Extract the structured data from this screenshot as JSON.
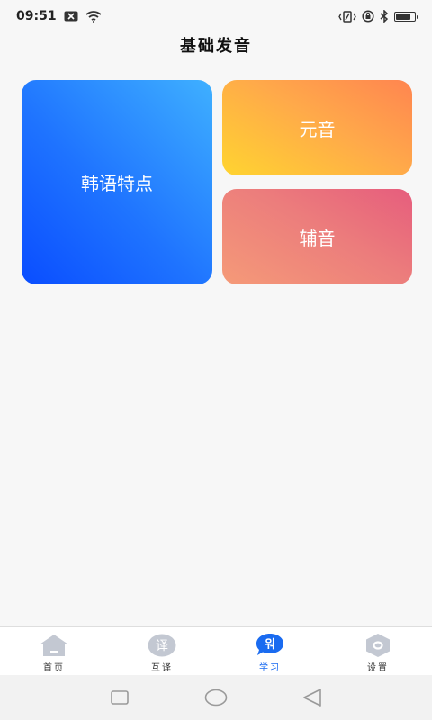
{
  "status_bar": {
    "time": "09:51",
    "icons": [
      "notification-x-icon",
      "wifi-icon",
      "vibrate-icon",
      "data-saver-icon",
      "bluetooth-icon",
      "battery-icon"
    ],
    "battery_level": 0.8
  },
  "header": {
    "title": "基础发音"
  },
  "cards": {
    "korean_features": {
      "label": "韩语特点"
    },
    "vowels": {
      "label": "元音"
    },
    "consonants": {
      "label": "辅音"
    }
  },
  "tab_bar": {
    "items": [
      {
        "label": "首页",
        "icon": "home-icon",
        "icon_text": "",
        "active": false
      },
      {
        "label": "互译",
        "icon": "translate-icon",
        "icon_text": "译",
        "active": false
      },
      {
        "label": "学习",
        "icon": "study-bubble-icon",
        "icon_text": "워",
        "active": true
      },
      {
        "label": "设置",
        "icon": "settings-hex-icon",
        "icon_text": "",
        "active": false
      }
    ]
  },
  "colors": {
    "accent": "#1a6bf0",
    "tab_icon_inactive": "#c3c8d2",
    "card_blue": "#1f74ff",
    "card_orange": "#ffa94a",
    "card_pink": "#ec7d7c"
  },
  "nav_bar": {
    "buttons": [
      "recent-apps-icon",
      "home-circle-icon",
      "back-triangle-icon"
    ]
  }
}
